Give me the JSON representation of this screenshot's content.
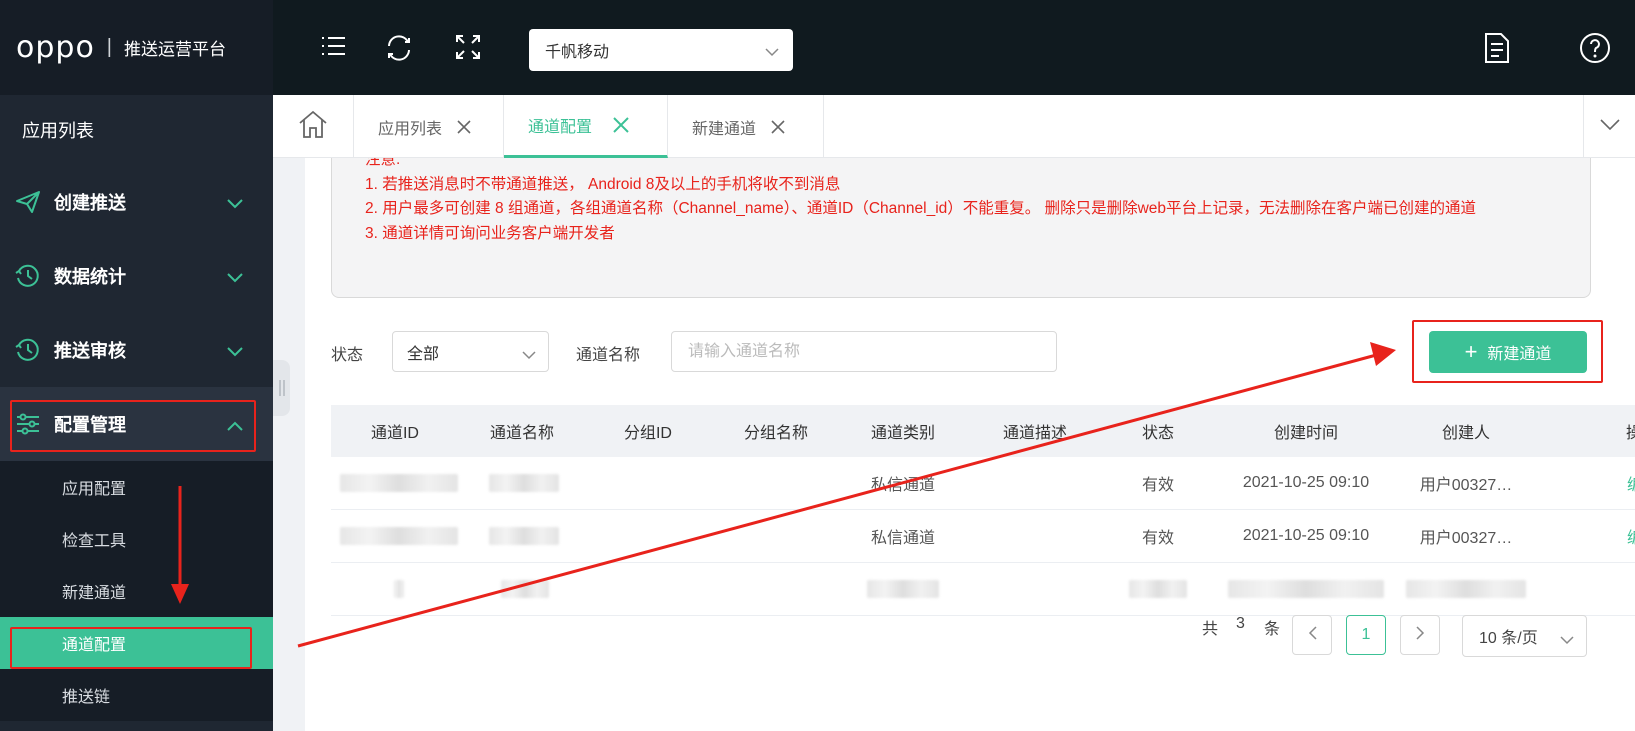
{
  "brand": {
    "logo": "oppo",
    "separator": "|",
    "platform": "推送运营平台"
  },
  "sidebar": {
    "title": "应用列表",
    "menus": [
      {
        "label": "创建推送",
        "icon": "paper-plane-icon"
      },
      {
        "label": "数据统计",
        "icon": "clock-history-icon"
      },
      {
        "label": "推送审核",
        "icon": "clock-history-icon"
      },
      {
        "label": "配置管理",
        "icon": "sliders-icon"
      }
    ],
    "submenu": [
      "应用配置",
      "检查工具",
      "新建通道",
      "通道配置",
      "推送链"
    ]
  },
  "topbar": {
    "app_select": "千帆移动",
    "icons": [
      "menu-icon",
      "refresh-icon",
      "fullscreen-icon",
      "document-icon",
      "help-icon"
    ]
  },
  "tabs": [
    {
      "label": "应用列表",
      "active": false
    },
    {
      "label": "通道配置",
      "active": true
    },
    {
      "label": "新建通道",
      "active": false
    }
  ],
  "notice": {
    "title": "注意:",
    "lines": [
      "1. 若推送消息时不带通道推送， Android 8及以上的手机将收不到消息",
      "2. 用户最多可创建 8 组通道，各组通道名称（Channel_name）、通道ID（Channel_id）不能重复。 删除只是删除web平台上记录，无法删除在客户端已创建的通道",
      "3. 通道详情可询问业务客户端开发者"
    ]
  },
  "filters": {
    "status_label": "状态",
    "status_value": "全部",
    "name_label": "通道名称",
    "name_placeholder": "请输入通道名称",
    "new_button": "新建通道"
  },
  "table": {
    "headers": [
      "通道ID",
      "通道名称",
      "分组ID",
      "分组名称",
      "通道类别",
      "通道描述",
      "状态",
      "创建时间",
      "创建人",
      "操"
    ],
    "rows": [
      {
        "type": "私信通道",
        "status": "有效",
        "created": "2021-10-25 09:10",
        "creator": "用户00327…",
        "action": "编辑"
      },
      {
        "type": "私信通道",
        "status": "有效",
        "created": "2021-10-25 09:10",
        "creator": "用户00327…",
        "action": "编辑"
      }
    ]
  },
  "pagination": {
    "total_prefix": "共",
    "total": "3",
    "total_suffix": "条",
    "prev": "<",
    "current": "1",
    "next": ">",
    "page_size": "10 条/页"
  },
  "colors": {
    "accent": "#3cc196",
    "annotation": "#e8231c",
    "sidebar_bg": "#1f2732",
    "topbar_bg": "#101a1f"
  }
}
